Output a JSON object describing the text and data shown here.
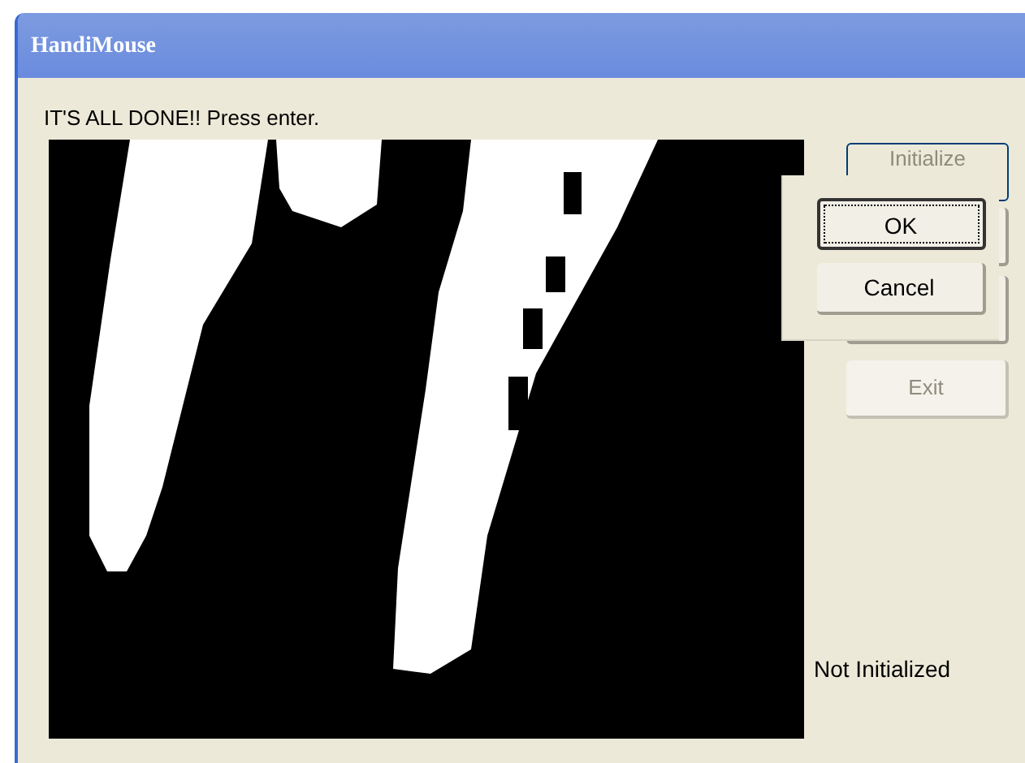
{
  "window": {
    "title": "HandiMouse"
  },
  "message": "IT'S ALL DONE!! Press enter.",
  "buttons": [
    {
      "label": "Initialize",
      "disabled": true
    },
    {
      "label": "Exit",
      "disabled": true
    }
  ],
  "dialog": {
    "buttons": [
      {
        "label": "OK",
        "focused": true
      },
      {
        "label": "Cancel",
        "focused": false
      }
    ]
  },
  "status": "Not Initialized"
}
